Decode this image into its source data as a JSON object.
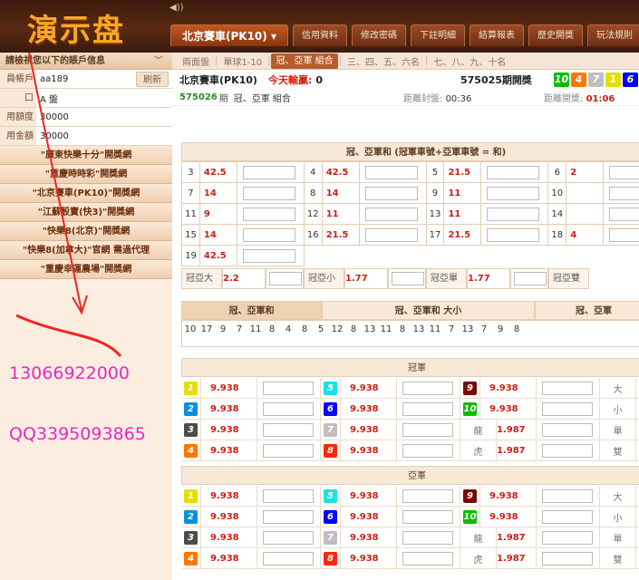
{
  "header": {
    "logo": "演示盘",
    "speaker_glyph": "◀))",
    "nav": [
      "北京賽車(PK10) ▾",
      "信用資料",
      "修改密碼",
      "下註明細",
      "結算報表",
      "歷史開獎",
      "玩法規則"
    ]
  },
  "sidebar": {
    "heading": "請檢視您以下的賬戶信息",
    "chevron": "﹀",
    "account": {
      "name_label": "員帳戶",
      "name_value": "aa189",
      "refresh_label": "刷新",
      "pan_label": "口",
      "pan_value": "A 盤",
      "credit_label": "用額度",
      "credit_value": "30000",
      "balance_label": "用金額",
      "balance_value": "30000"
    },
    "links": [
      "\"廣東快樂十分\"開獎網",
      "\"重慶時時彩\"開獎網",
      "\"北京賽車(PK10)\"開獎網",
      "\"江蘇骰寶(快3)\"開獎網",
      "\"快樂8(北京)\"開獎網",
      "\"快樂8(加拿大)\"官網 需過代理",
      "\"重慶幸運農場\"開獎網"
    ],
    "contact_phone": "13066922000",
    "contact_qq": "QQ3395093865"
  },
  "subtabs": [
    "兩面盤",
    "單球1-10",
    "冠、亞軍 組合",
    "三、四、五、六名",
    "七、八、九、十名"
  ],
  "info": {
    "game_name": "北京賽車(PK10)",
    "today_label": "今天輸贏:",
    "today_value": "0",
    "draw_no": "575025期開獎",
    "balls": [
      "10",
      "4",
      "7",
      "1",
      "6"
    ],
    "current_draw": "575026",
    "current_suffix": "期",
    "current_play": "冠、亞軍 組合",
    "close_label": "距離封盤:",
    "close_value": "00:36",
    "open_label": "距離開獎:",
    "open_value": "01:06"
  },
  "sum_section": {
    "title": "冠、亞軍和 (冠軍車號+亞軍車號 = 和)",
    "rows": [
      [
        [
          "3",
          "42.5"
        ],
        [
          "4",
          "42.5"
        ],
        [
          "5",
          "21.5"
        ],
        [
          "6",
          "2"
        ]
      ],
      [
        [
          "7",
          "14"
        ],
        [
          "8",
          "14"
        ],
        [
          "9",
          "11"
        ],
        [
          "10",
          ""
        ]
      ],
      [
        [
          "11",
          "9"
        ],
        [
          "12",
          "11"
        ],
        [
          "13",
          "11"
        ],
        [
          "14",
          ""
        ]
      ],
      [
        [
          "15",
          "14"
        ],
        [
          "16",
          "21.5"
        ],
        [
          "17",
          "21.5"
        ],
        [
          "18",
          "4"
        ]
      ],
      [
        [
          "19",
          "42.5"
        ]
      ]
    ]
  },
  "hl": [
    [
      "冠亞大",
      "2.2"
    ],
    [
      "冠亞小",
      "1.77"
    ],
    [
      "冠亞單",
      "1.77"
    ],
    [
      "冠亞雙",
      ""
    ]
  ],
  "stats": {
    "tabs": [
      "冠、亞軍和",
      "冠、亞軍和 大小",
      "冠、亞軍"
    ],
    "numbers": [
      "10",
      "17",
      "9",
      "7",
      "11",
      "8",
      "4",
      "8",
      "5",
      "12",
      "8",
      "13",
      "11",
      "8",
      "13",
      "11",
      "7",
      "13",
      "7",
      "9",
      "8"
    ]
  },
  "champion": {
    "title": "冠軍",
    "rows": [
      {
        "a": "1",
        "ao": "9.938",
        "b": "5",
        "bo": "9.938",
        "c": "9",
        "co": "9.938",
        "d": "大"
      },
      {
        "a": "2",
        "ao": "9.938",
        "b": "6",
        "bo": "9.938",
        "c": "10",
        "co": "9.938",
        "d": "小"
      },
      {
        "a": "3",
        "ao": "9.938",
        "b": "7",
        "bo": "9.938",
        "ct": "龍",
        "co": "1.987",
        "d": "單"
      },
      {
        "a": "4",
        "ao": "9.938",
        "b": "8",
        "bo": "9.938",
        "ct": "虎",
        "co": "1.987",
        "d": "雙"
      }
    ]
  },
  "runnerup": {
    "title": "亞軍",
    "rows": [
      {
        "a": "1",
        "ao": "9.938",
        "b": "5",
        "bo": "9.938",
        "c": "9",
        "co": "9.938",
        "d": "大"
      },
      {
        "a": "2",
        "ao": "9.938",
        "b": "6",
        "bo": "9.938",
        "c": "10",
        "co": "9.938",
        "d": "小"
      },
      {
        "a": "3",
        "ao": "9.938",
        "b": "7",
        "bo": "9.938",
        "ct": "龍",
        "co": "1.987",
        "d": "單"
      },
      {
        "a": "4",
        "ao": "9.938",
        "b": "8",
        "bo": "9.938",
        "ct": "虎",
        "co": "1.987",
        "d": "雙"
      }
    ]
  },
  "ball_colors": {
    "1": "#e6de00",
    "2": "#0092dd",
    "3": "#4b4b4b",
    "4": "#ff7600",
    "5": "#17e2e5",
    "6": "#0000ff",
    "7": "#bfbfbf",
    "8": "#ff2600",
    "9": "#780b00",
    "10": "#07bf00"
  },
  "accent_colors": {
    "header": "#4a220f",
    "odds": "#cf1f14",
    "sidebar_bg": "#fbeee0",
    "contact": "#ea27c6"
  }
}
